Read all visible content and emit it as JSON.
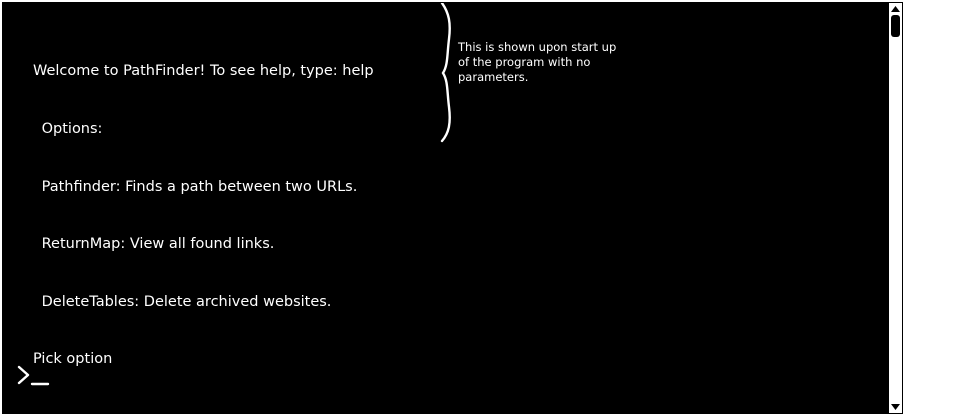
{
  "console": {
    "lines": [
      "Welcome to PathFinder! To see help, type: help",
      " Options:",
      " Pathfinder: Finds a path between two URLs.",
      " ReturnMap: View all found links.",
      " DeleteTables: Delete archived websites.",
      "Pick option"
    ],
    "annotation": "This is shown upon start up of the program with no parameters.",
    "prompt_icon": "terminal-prompt-icon",
    "background_color": "#000000",
    "text_color": "#ffffff"
  },
  "scrollbar": {
    "up_icon": "chevron-up-icon",
    "down_icon": "chevron-down-icon"
  }
}
